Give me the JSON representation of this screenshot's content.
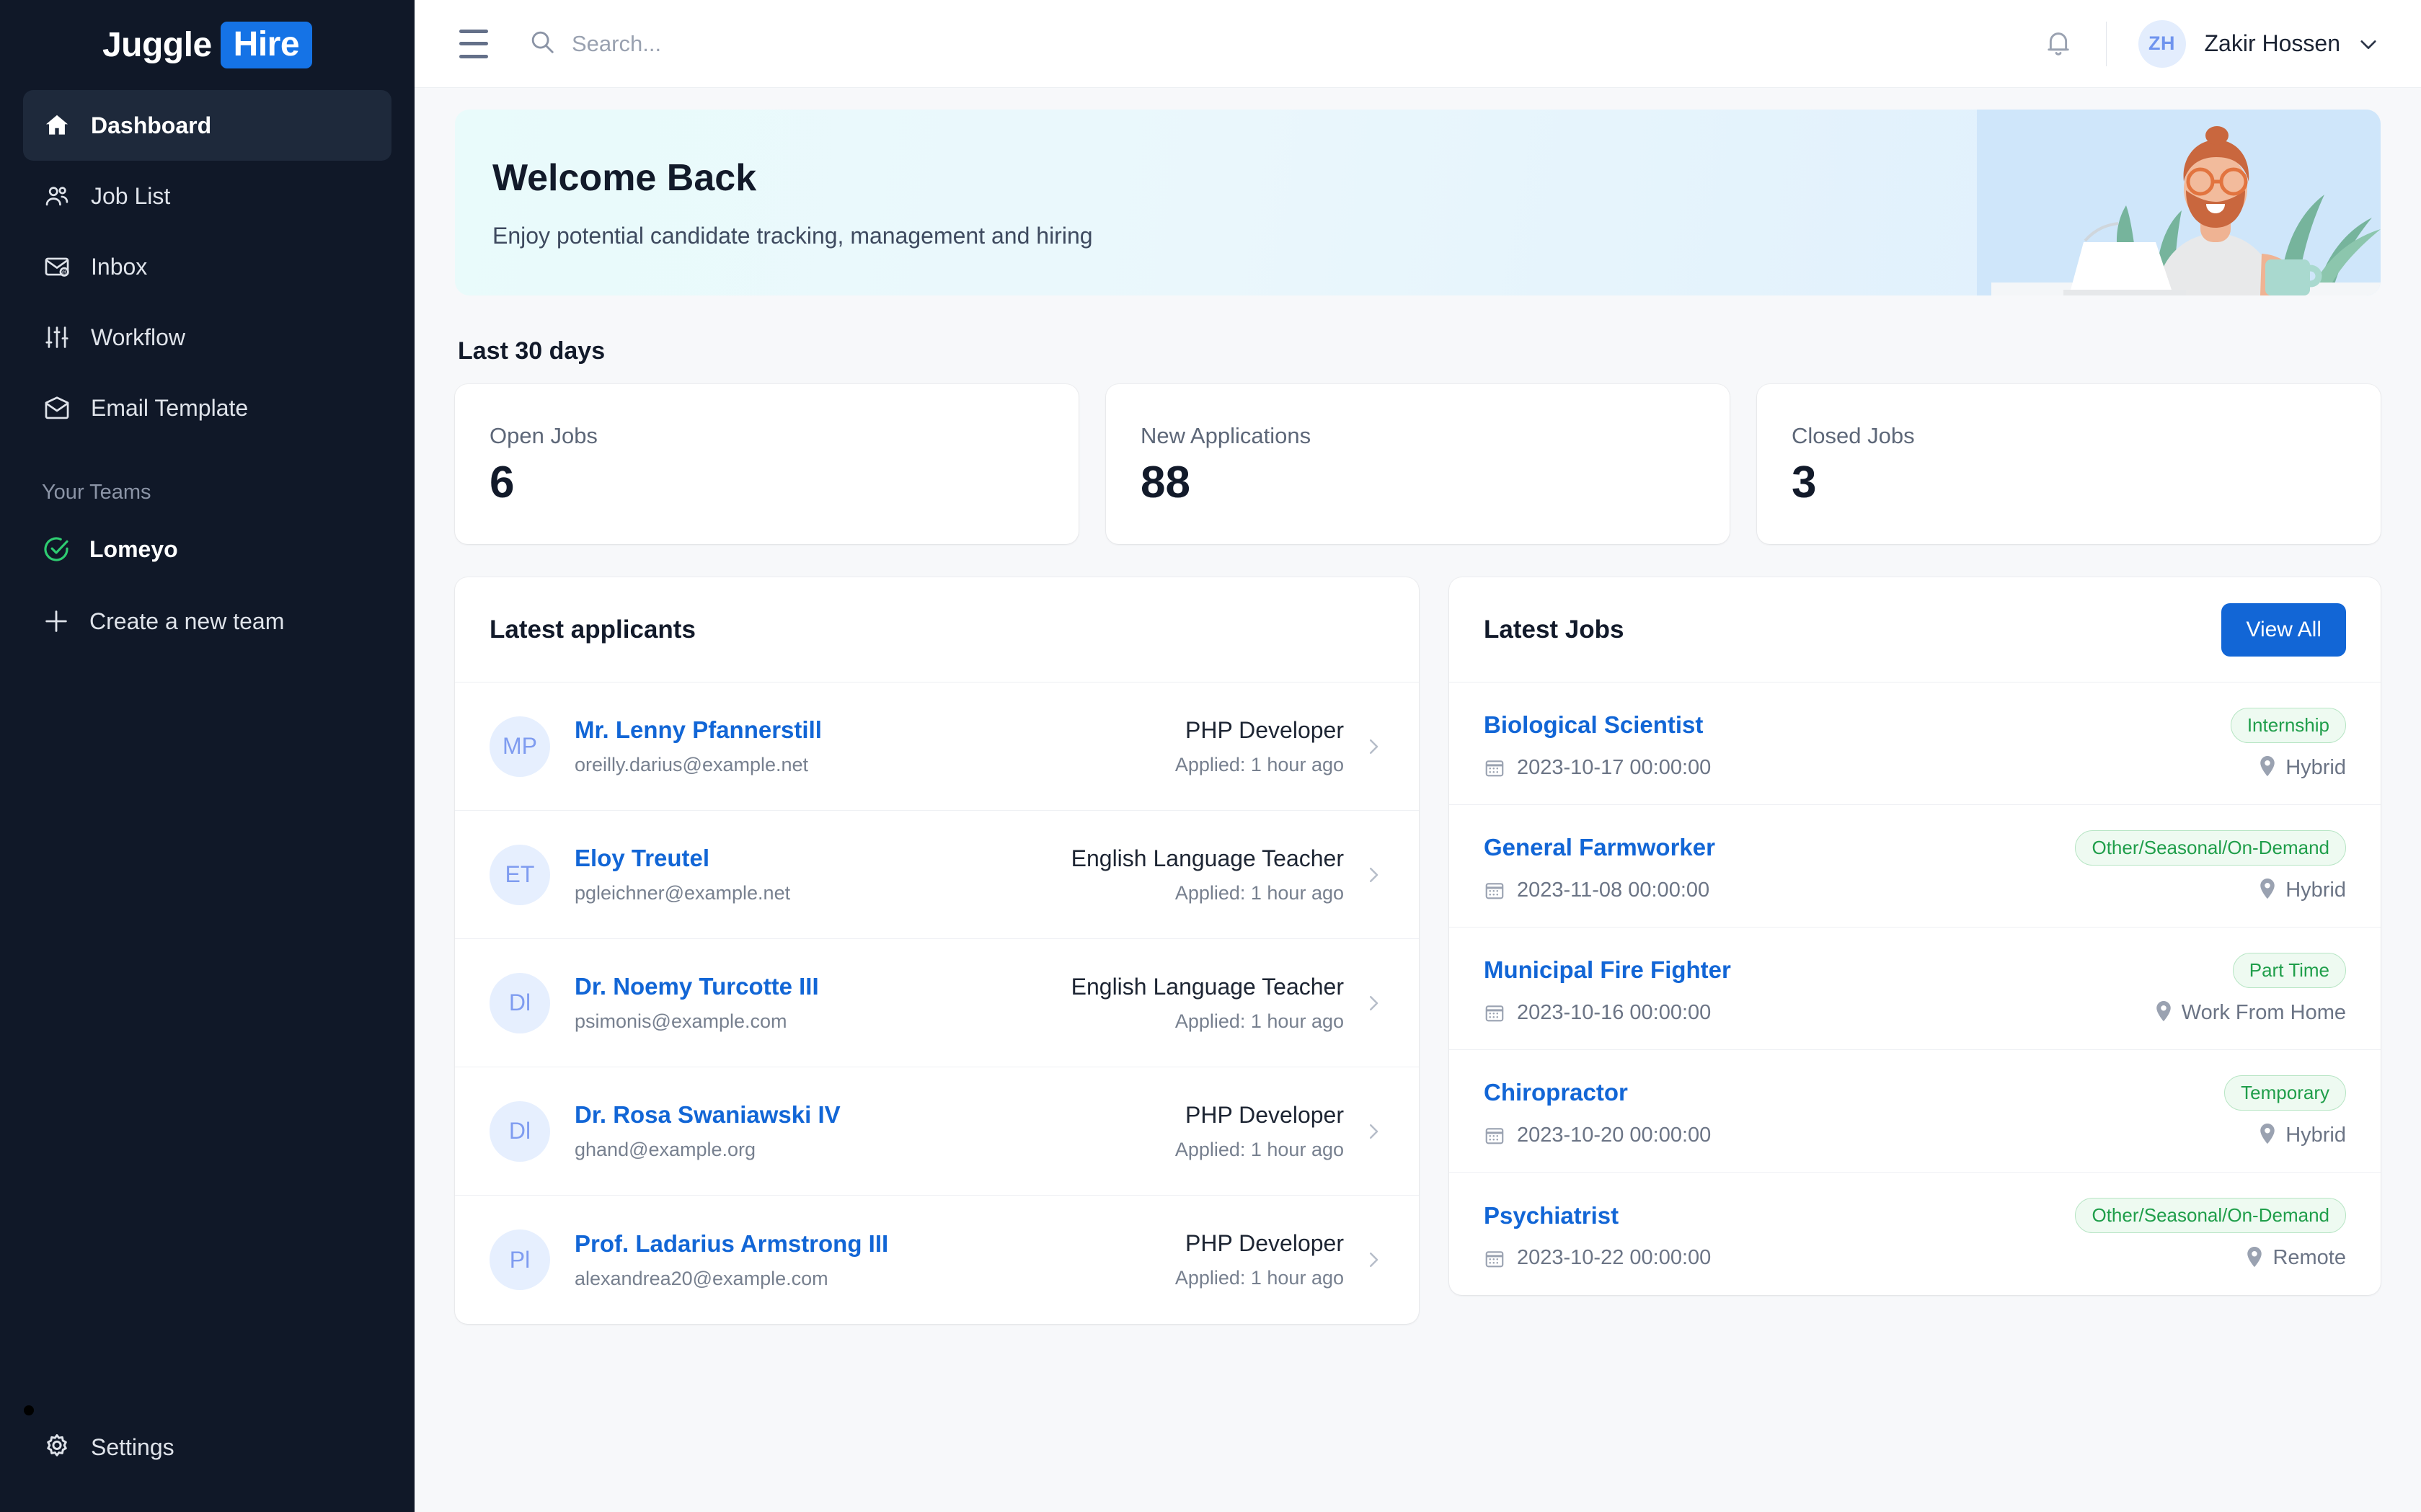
{
  "brand": {
    "word1": "Juggle",
    "word2": "Hire",
    "accent": "#1573e6"
  },
  "sidebar": {
    "nav": [
      {
        "label": "Dashboard",
        "icon": "home-icon",
        "active": true
      },
      {
        "label": "Job List",
        "icon": "users-icon",
        "active": false
      },
      {
        "label": "Inbox",
        "icon": "inbox-mail-icon",
        "active": false
      },
      {
        "label": "Workflow",
        "icon": "sliders-icon",
        "active": false
      },
      {
        "label": "Email Template",
        "icon": "email-template-icon",
        "active": false
      }
    ],
    "teams_label": "Your Teams",
    "team": {
      "label": "Lomeyo",
      "icon": "check-circle-icon",
      "color": "#2ecc71"
    },
    "create_team": {
      "label": "Create a new team",
      "icon": "plus-icon"
    },
    "settings": {
      "label": "Settings",
      "icon": "gear-icon"
    }
  },
  "topbar": {
    "menu_icon": "hamburger-icon",
    "search": {
      "icon": "search-icon",
      "placeholder": "Search...",
      "value": ""
    },
    "notification_icon": "bell-icon",
    "user": {
      "initials": "ZH",
      "name": "Zakir Hossen",
      "chevron": "chevron-down-icon"
    }
  },
  "banner": {
    "title": "Welcome Back",
    "subtitle": "Enjoy potential candidate tracking, management and hiring"
  },
  "stats": {
    "section_label": "Last 30 days",
    "cards": [
      {
        "label": "Open Jobs",
        "value": "6"
      },
      {
        "label": "New Applications",
        "value": "88"
      },
      {
        "label": "Closed Jobs",
        "value": "3"
      }
    ]
  },
  "applicants_panel": {
    "title": "Latest applicants",
    "rows": [
      {
        "initials": "MP",
        "name": "Mr. Lenny Pfannerstill",
        "email": "oreilly.darius@example.net",
        "job": "PHP Developer",
        "applied": "Applied: 1 hour ago"
      },
      {
        "initials": "ET",
        "name": "Eloy Treutel",
        "email": "pgleichner@example.net",
        "job": "English Language Teacher",
        "applied": "Applied: 1 hour ago"
      },
      {
        "initials": "Dl",
        "name": "Dr. Noemy Turcotte III",
        "email": "psimonis@example.com",
        "job": "English Language Teacher",
        "applied": "Applied: 1 hour ago"
      },
      {
        "initials": "Dl",
        "name": "Dr. Rosa Swaniawski IV",
        "email": "ghand@example.org",
        "job": "PHP Developer",
        "applied": "Applied: 1 hour ago"
      },
      {
        "initials": "Pl",
        "name": "Prof. Ladarius Armstrong III",
        "email": "alexandrea20@example.com",
        "job": "PHP Developer",
        "applied": "Applied: 1 hour ago"
      }
    ]
  },
  "jobs_panel": {
    "title": "Latest Jobs",
    "view_all_label": "View All",
    "rows": [
      {
        "title": "Biological Scientist",
        "badge": "Internship",
        "date": "2023-10-17 00:00:00",
        "location": "Hybrid"
      },
      {
        "title": "General Farmworker",
        "badge": "Other/Seasonal/On-Demand",
        "date": "2023-11-08 00:00:00",
        "location": "Hybrid"
      },
      {
        "title": "Municipal Fire Fighter",
        "badge": "Part Time",
        "date": "2023-10-16 00:00:00",
        "location": "Work From Home"
      },
      {
        "title": "Chiropractor",
        "badge": "Temporary",
        "date": "2023-10-20 00:00:00",
        "location": "Hybrid"
      },
      {
        "title": "Psychiatrist",
        "badge": "Other/Seasonal/On-Demand",
        "date": "2023-10-22 00:00:00",
        "location": "Remote"
      }
    ]
  }
}
